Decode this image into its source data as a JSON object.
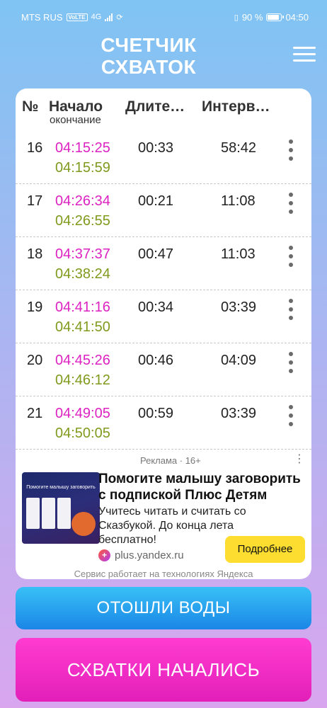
{
  "status_bar": {
    "carrier": "MTS RUS",
    "volte": "VoLTE",
    "network": "4G",
    "battery_percent": "90 %",
    "battery_level": 0.9,
    "time": "04:50"
  },
  "header": {
    "title_line1": "СЧЕТЧИК",
    "title_line2": "СХВАТОК",
    "menu_icon": "hamburger-icon"
  },
  "table": {
    "headers": {
      "number": "№",
      "start": "Начало",
      "start_sub": "окончание",
      "duration": "Длите…",
      "interval": "Интерв…"
    },
    "rows": [
      {
        "no": "16",
        "start": "04:15:25",
        "end": "04:15:59",
        "duration": "00:33",
        "interval": "58:42"
      },
      {
        "no": "17",
        "start": "04:26:34",
        "end": "04:26:55",
        "duration": "00:21",
        "interval": "11:08"
      },
      {
        "no": "18",
        "start": "04:37:37",
        "end": "04:38:24",
        "duration": "00:47",
        "interval": "11:03"
      },
      {
        "no": "19",
        "start": "04:41:16",
        "end": "04:41:50",
        "duration": "00:34",
        "interval": "03:39"
      },
      {
        "no": "20",
        "start": "04:45:26",
        "end": "04:46:12",
        "duration": "00:46",
        "interval": "04:09"
      },
      {
        "no": "21",
        "start": "04:49:05",
        "end": "04:50:05",
        "duration": "00:59",
        "interval": "03:39"
      }
    ]
  },
  "ad": {
    "label": "Реклама · 16+",
    "headline": "Помогите малышу заговорить с подпиской Плюс Детям",
    "body": "Учитесь читать и считать со Сказбукой. До конца лета бесплатно!",
    "domain": "plus.yandex.ru",
    "cta": "Подробнее",
    "footer": "Сервис работает на технологиях Яндекса",
    "thumb_title": "Помогите малышу заговорить"
  },
  "buttons": {
    "water": "ОТОШЛИ ВОДЫ",
    "start": "СХВАТКИ НАЧАЛИСЬ"
  },
  "colors": {
    "start_time": "#dd22c2",
    "end_time": "#7f9a1c",
    "water_button": "#1a86e6",
    "start_button": "#e21fb8",
    "ad_cta": "#fddd2f"
  }
}
